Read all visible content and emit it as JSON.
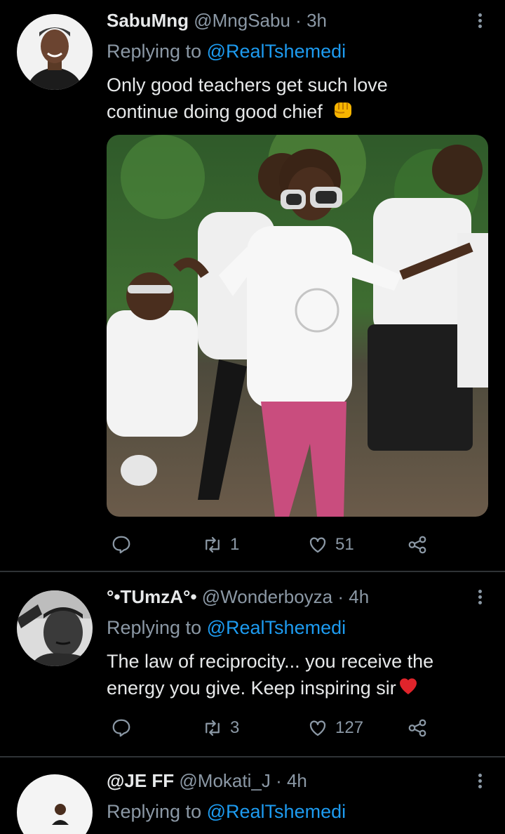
{
  "tweets": [
    {
      "name": "SabuMng",
      "handle": "@MngSabu",
      "time": "3h",
      "replying_prefix": "Replying to",
      "replying_to": "@RealTshemedi",
      "text_line1": "Only good teachers get such love",
      "text_line2": "continue doing good chief",
      "emoji": "fist-emoji",
      "replies": "",
      "retweets": "1",
      "likes": "51"
    },
    {
      "name": "°•TUmzA°•",
      "handle": "@Wonderboyza",
      "time": "4h",
      "replying_prefix": "Replying to",
      "replying_to": "@RealTshemedi",
      "text_line1": "The law of reciprocity... you receive the",
      "text_line2": "energy you give. Keep inspiring sir",
      "emoji": "heart-emoji",
      "replies": "",
      "retweets": "3",
      "likes": "127"
    },
    {
      "name": "@JE FF",
      "handle": "@Mokati_J",
      "time": "4h",
      "replying_prefix": "Replying to",
      "replying_to": "@RealTshemedi"
    }
  ],
  "colors": {
    "background": "#000000",
    "text": "#e7e9ea",
    "muted": "#8b98a5",
    "link": "#1d9bf0",
    "divider": "#2f3336"
  },
  "icons": [
    "reply-icon",
    "retweet-icon",
    "like-icon",
    "share-icon",
    "more-icon"
  ]
}
